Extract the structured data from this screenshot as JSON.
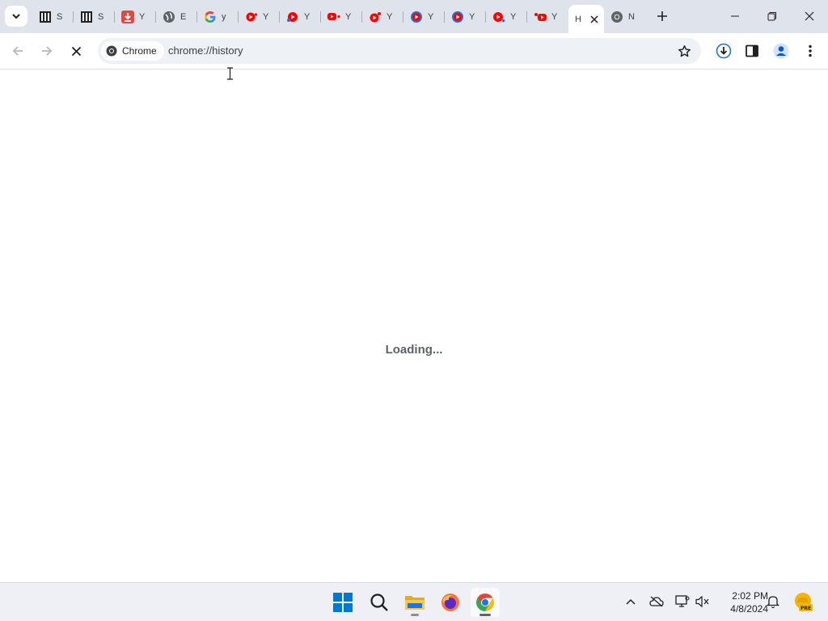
{
  "tabs": [
    {
      "title": "S",
      "icon": "library-icon"
    },
    {
      "title": "S",
      "icon": "library-icon"
    },
    {
      "title": "Y",
      "icon": "download-icon"
    },
    {
      "title": "E",
      "icon": "globe-icon"
    },
    {
      "title": "y",
      "icon": "google-icon"
    },
    {
      "title": "Y",
      "icon": "youtube-icon"
    },
    {
      "title": "Y",
      "icon": "youtube-icon"
    },
    {
      "title": "Y",
      "icon": "youtube-icon"
    },
    {
      "title": "Y",
      "icon": "youtube-icon"
    },
    {
      "title": "Y",
      "icon": "youtube-icon"
    },
    {
      "title": "Y",
      "icon": "youtube-icon"
    },
    {
      "title": "Y",
      "icon": "youtube-icon"
    },
    {
      "title": "Y",
      "icon": "youtube-icon"
    }
  ],
  "active_tab": {
    "title": "H"
  },
  "last_tab": {
    "title": "N",
    "icon": "chrome-icon"
  },
  "omnibox": {
    "chip_label": "Chrome",
    "url": "chrome://history"
  },
  "content": {
    "loading_text": "Loading..."
  },
  "taskbar": {
    "apps": [
      "windows-start",
      "search",
      "file-explorer",
      "firefox",
      "chrome"
    ],
    "clock_time": "2:02 PM",
    "clock_date": "4/8/2024",
    "weather_badge": "PRE"
  },
  "colors": {
    "tabstrip_bg": "#dfe3eb",
    "omnibox_bg": "#eef1f6",
    "accent_blue": "#1a73e8",
    "youtube_red": "#ff0000"
  }
}
